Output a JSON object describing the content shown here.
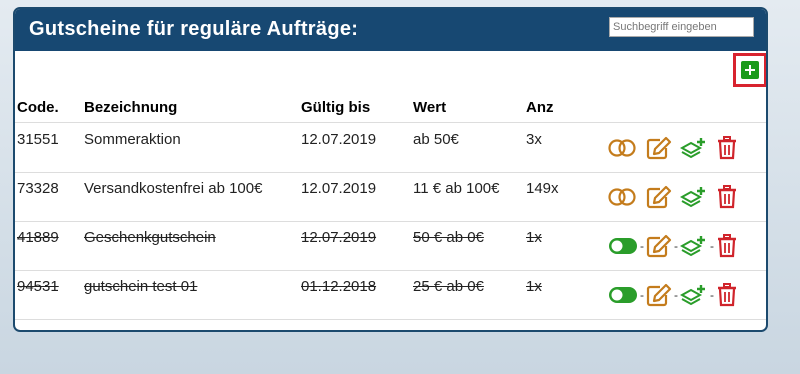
{
  "header": {
    "title": "Gutscheine für reguläre Aufträge:",
    "search_placeholder": "Suchbegriff eingeben"
  },
  "columns": [
    "Code.",
    "Bezeichnung",
    "Gültig bis",
    "Wert",
    "Anz"
  ],
  "rows": [
    {
      "code": "31551",
      "name": "Sommeraktion",
      "date": "12.07.2019",
      "wert": "ab 50€",
      "anz": "3x",
      "active": false,
      "struck": false
    },
    {
      "code": "73328",
      "name": "Versandkostenfrei ab 100€",
      "date": "12.07.2019",
      "wert": "11 € ab 100€",
      "anz": "149x",
      "active": false,
      "struck": false
    },
    {
      "code": "41889",
      "name": "Geschenkgutschein",
      "date": "12.07.2019",
      "wert": "50 € ab 0€",
      "anz": "1x",
      "active": true,
      "struck": true
    },
    {
      "code": "94531",
      "name": "gutschein test 01",
      "date": "01.12.2018",
      "wert": "25 € ab 0€",
      "anz": "1x",
      "active": true,
      "struck": true
    }
  ],
  "separator": "-",
  "colors": {
    "header_bg": "#174872",
    "add_green": "#1a9b1a",
    "add_border": "#d8232f",
    "toggle_off": "#c47c1c",
    "toggle_on": "#2a9d2a",
    "edit": "#c47c1c",
    "copy": "#2a9d2a",
    "delete": "#d0242b"
  },
  "icons": {
    "add": "plus-square-icon",
    "toggle": "toggle-icon",
    "edit": "edit-icon",
    "copy": "layers-plus-icon",
    "delete": "trash-icon"
  }
}
